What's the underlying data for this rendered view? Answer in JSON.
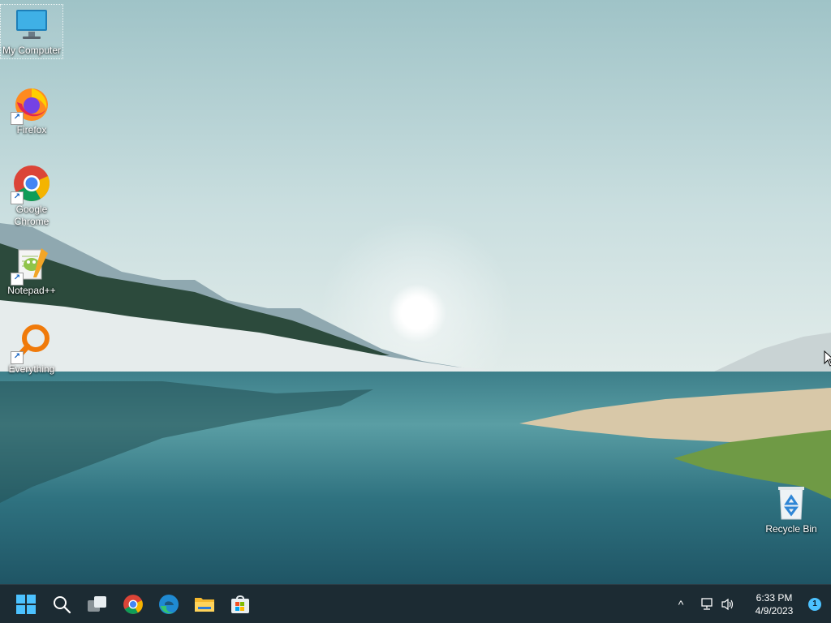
{
  "desktop": {
    "icons": [
      {
        "label": "My Computer",
        "icon": "monitor-icon",
        "selected": true
      },
      {
        "label": "Firefox",
        "icon": "firefox-icon",
        "shortcut": true
      },
      {
        "label": "Google Chrome",
        "icon": "chrome-icon",
        "shortcut": true
      },
      {
        "label": "Notepad++",
        "icon": "notepadpp-icon",
        "shortcut": true
      },
      {
        "label": "Everything",
        "icon": "everything-search-icon",
        "shortcut": true
      },
      {
        "label": "Recycle Bin",
        "icon": "recycle-bin-icon"
      }
    ]
  },
  "taskbar": {
    "pinned": [
      {
        "name": "Start",
        "icon": "windows-start-icon"
      },
      {
        "name": "Search",
        "icon": "search-icon"
      },
      {
        "name": "Task View",
        "icon": "task-view-icon"
      },
      {
        "name": "Google Chrome",
        "icon": "chrome-icon"
      },
      {
        "name": "Microsoft Edge",
        "icon": "edge-icon"
      },
      {
        "name": "File Explorer",
        "icon": "folder-icon"
      },
      {
        "name": "Microsoft Store",
        "icon": "store-icon"
      }
    ],
    "tray": {
      "chevron": "^",
      "time": "6:33 PM",
      "date": "4/9/2023",
      "notification_count": "1"
    }
  },
  "colors": {
    "taskbar_bg": "#1c2b33",
    "accent": "#4cc2ff",
    "sky": "#b8d2d4",
    "water": "#2d6c78"
  }
}
